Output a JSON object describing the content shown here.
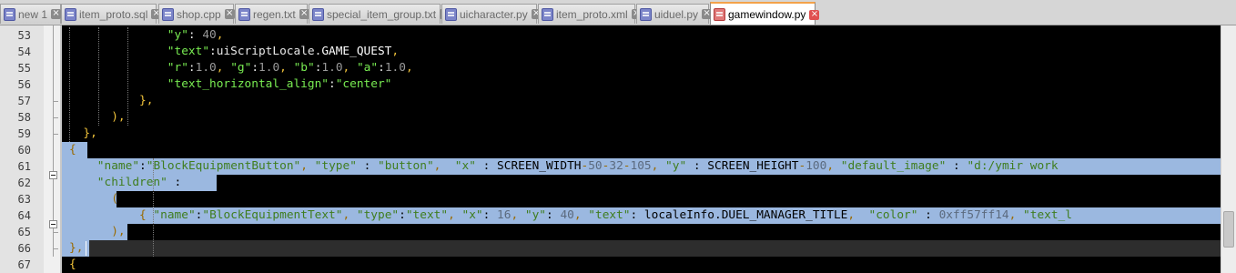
{
  "tabs": [
    {
      "label": "new 1",
      "icon": "blue-file-icon",
      "active": false
    },
    {
      "label": "item_proto.sql",
      "icon": "blue-file-icon",
      "active": false
    },
    {
      "label": "shop.cpp",
      "icon": "blue-file-icon",
      "active": false
    },
    {
      "label": "regen.txt",
      "icon": "blue-file-icon",
      "active": false
    },
    {
      "label": "special_item_group.txt",
      "icon": "blue-file-icon",
      "active": false
    },
    {
      "label": "uicharacter.py",
      "icon": "blue-file-icon",
      "active": false
    },
    {
      "label": "item_proto.xml",
      "icon": "blue-file-icon",
      "active": false
    },
    {
      "label": "uiduel.py",
      "icon": "blue-file-icon",
      "active": false
    },
    {
      "label": "gamewindow.py",
      "icon": "red-file-icon",
      "active": true
    }
  ],
  "editor": {
    "colors": {
      "string": "#79ec52",
      "operator": "#f0c23a",
      "number": "#9a9a9a",
      "selection": "#9bb8e0",
      "current_line": "#2d2d2d"
    },
    "lines": [
      {
        "num": "53",
        "segments": [
          [
            "s",
            "\"y\""
          ],
          [
            "p",
            ": "
          ],
          [
            "n",
            "40"
          ],
          [
            "o",
            ","
          ]
        ]
      },
      {
        "num": "54",
        "segments": [
          [
            "s",
            "\"text\""
          ],
          [
            "p",
            ":uiScriptLocale."
          ],
          [
            "w",
            "GAME_QUEST"
          ],
          [
            "o",
            ","
          ]
        ]
      },
      {
        "num": "55",
        "segments": [
          [
            "s",
            "\"r\""
          ],
          [
            "p",
            ":"
          ],
          [
            "n",
            "1.0"
          ],
          [
            "o",
            ", "
          ],
          [
            "s",
            "\"g\""
          ],
          [
            "p",
            ":"
          ],
          [
            "n",
            "1.0"
          ],
          [
            "o",
            ", "
          ],
          [
            "s",
            "\"b\""
          ],
          [
            "p",
            ":"
          ],
          [
            "n",
            "1.0"
          ],
          [
            "o",
            ", "
          ],
          [
            "s",
            "\"a\""
          ],
          [
            "p",
            ":"
          ],
          [
            "n",
            "1.0"
          ],
          [
            "o",
            ","
          ]
        ]
      },
      {
        "num": "56",
        "segments": [
          [
            "s",
            "\"text_horizontal_align\""
          ],
          [
            "p",
            ":"
          ],
          [
            "s",
            "\"center\""
          ]
        ]
      },
      {
        "num": "57",
        "segments": [
          [
            "o",
            "},"
          ]
        ]
      },
      {
        "num": "58",
        "segments": [
          [
            "o",
            "),"
          ]
        ]
      },
      {
        "num": "59",
        "segments": [
          [
            "o",
            "},"
          ]
        ]
      },
      {
        "num": "60",
        "segments": [
          [
            "o",
            "{"
          ]
        ]
      },
      {
        "num": "61",
        "segments": [
          [
            "s",
            "\"name\""
          ],
          [
            "p",
            ":"
          ],
          [
            "s",
            "\"BlockEquipmentButton\""
          ],
          [
            "o",
            ", "
          ],
          [
            "s",
            "\"type\""
          ],
          [
            "p",
            " : "
          ],
          [
            "s",
            "\"button\""
          ],
          [
            "o",
            ",  "
          ],
          [
            "s",
            "\"x\""
          ],
          [
            "p",
            " : "
          ],
          [
            "w",
            "SCREEN_WIDTH"
          ],
          [
            "o",
            "-"
          ],
          [
            "n",
            "50"
          ],
          [
            "o",
            "-"
          ],
          [
            "n",
            "32"
          ],
          [
            "o",
            "-"
          ],
          [
            "n",
            "105"
          ],
          [
            "o",
            ", "
          ],
          [
            "s",
            "\"y\""
          ],
          [
            "p",
            " : "
          ],
          [
            "w",
            "SCREEN_HEIGHT"
          ],
          [
            "o",
            "-"
          ],
          [
            "n",
            "100"
          ],
          [
            "o",
            ", "
          ],
          [
            "s",
            "\"default_image\""
          ],
          [
            "p",
            " : "
          ],
          [
            "s",
            "\"d:/ymir work"
          ]
        ]
      },
      {
        "num": "62",
        "segments": [
          [
            "s",
            "\"children\""
          ],
          [
            "p",
            " :"
          ]
        ]
      },
      {
        "num": "63",
        "segments": [
          [
            "o",
            "("
          ]
        ]
      },
      {
        "num": "64",
        "segments": [
          [
            "o",
            "{ "
          ],
          [
            "s",
            "\"name\""
          ],
          [
            "p",
            ":"
          ],
          [
            "s",
            "\"BlockEquipmentText\""
          ],
          [
            "o",
            ", "
          ],
          [
            "s",
            "\"type\""
          ],
          [
            "p",
            ":"
          ],
          [
            "s",
            "\"text\""
          ],
          [
            "o",
            ", "
          ],
          [
            "s",
            "\"x\""
          ],
          [
            "p",
            ": "
          ],
          [
            "n",
            "16"
          ],
          [
            "o",
            ", "
          ],
          [
            "s",
            "\"y\""
          ],
          [
            "p",
            ": "
          ],
          [
            "n",
            "40"
          ],
          [
            "o",
            ", "
          ],
          [
            "s",
            "\"text\""
          ],
          [
            "p",
            ": localeInfo."
          ],
          [
            "w",
            "DUEL_MANAGER_TITLE"
          ],
          [
            "o",
            ",  "
          ],
          [
            "s",
            "\"color\""
          ],
          [
            "p",
            " : "
          ],
          [
            "n",
            "0xff57ff14"
          ],
          [
            "o",
            ", "
          ],
          [
            "s",
            "\"text_l"
          ]
        ]
      },
      {
        "num": "65",
        "segments": [
          [
            "o",
            "),"
          ]
        ]
      },
      {
        "num": "66",
        "segments": [
          [
            "o",
            "},"
          ]
        ]
      },
      {
        "num": "67",
        "segments": [
          [
            "o",
            "{"
          ]
        ]
      }
    ]
  }
}
